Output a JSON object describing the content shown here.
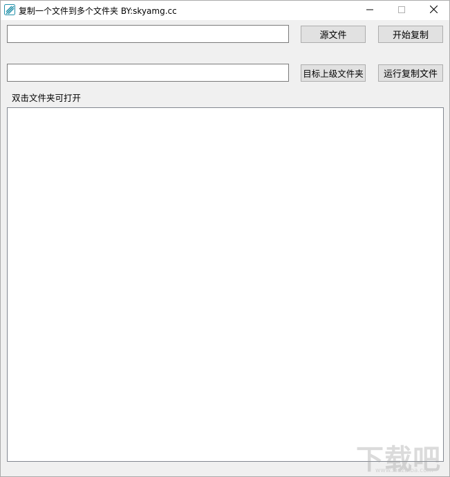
{
  "window": {
    "title": "复制一个文件到多个文件夹  BY:skyamg.cc",
    "icon": "app-logo-icon",
    "controls": [
      "minimize-icon",
      "maximize-icon",
      "close-icon"
    ]
  },
  "source_path": {
    "value": "",
    "placeholder": ""
  },
  "target_path": {
    "value": "",
    "placeholder": ""
  },
  "buttons": {
    "source_file": "源文件",
    "start_copy": "开始复制",
    "target_parent_folder": "目标上级文件夹",
    "run_copy_file": "运行复制文件"
  },
  "hint": "双击文件夹可打开",
  "folder_list": {
    "items": []
  },
  "watermark": {
    "text": "下载吧",
    "sub": "www.xiazaiba.com"
  },
  "colors": {
    "titlebar": "#ffffff",
    "window_bg": "#f0f0f0",
    "button_bg": "#e1e1e1",
    "icon_accent": "#1f8fa8"
  }
}
